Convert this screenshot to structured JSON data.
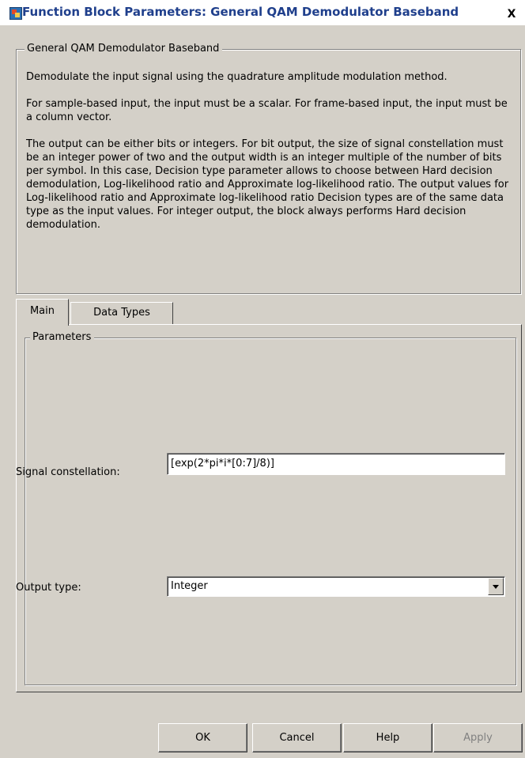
{
  "window": {
    "title": "Function Block Parameters: General QAM Demodulator Baseband",
    "close_label": "X"
  },
  "description": {
    "group_label": "General QAM Demodulator Baseband",
    "paragraphs": [
      "Demodulate the input signal using the quadrature amplitude modulation method.",
      "For sample-based input, the input must be a scalar. For frame-based input, the input must be a column vector.",
      "The output can be either bits or integers. For bit output, the size of signal constellation must be an integer power of two and the output width is an integer multiple of the number of bits per symbol. In this case, Decision type parameter allows to choose between Hard decision demodulation, Log-likelihood ratio and Approximate log-likelihood ratio. The output values for Log-likelihood ratio and Approximate log-likelihood ratio Decision types are of the same data type as the input values. For integer output, the block always performs Hard decision demodulation."
    ]
  },
  "tabs": [
    {
      "label": "Main",
      "active": true
    },
    {
      "label": "Data Types",
      "active": false
    }
  ],
  "parameters": {
    "group_label": "Parameters",
    "signal_constellation": {
      "label": "Signal constellation:",
      "value": "[exp(2*pi*i*[0:7]/8)]"
    },
    "output_type": {
      "label": "Output type:",
      "value": "Integer"
    }
  },
  "buttons": {
    "ok": "OK",
    "cancel": "Cancel",
    "help": "Help",
    "apply": "Apply"
  },
  "colors": {
    "dialog_background": "#d4d0c8",
    "title_text": "#1f3f8c",
    "disabled_text": "#808080"
  }
}
